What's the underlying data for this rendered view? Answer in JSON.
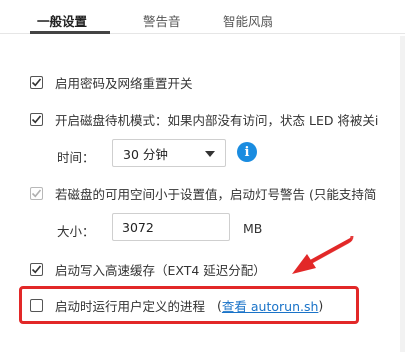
{
  "tabs": [
    {
      "label": "一般设置",
      "active": true
    },
    {
      "label": "警告音",
      "active": false
    },
    {
      "label": "智能风扇",
      "active": false
    }
  ],
  "settings": {
    "password_reset": {
      "label": "启用密码及网络重置开关",
      "checked": true
    },
    "disk_standby": {
      "label": "开启磁盘待机模式：如果内部没有访问，状态 LED 将被关i",
      "checked": true
    },
    "time_label": "时间：",
    "time_value": "30 分钟",
    "info_glyph": "i",
    "space_warning": {
      "label": "若磁盘的可用空间小于设置值，启动灯号警告 (只能支持简",
      "checked": true,
      "disabled": true
    },
    "size_label": "大小：",
    "size_value": "3072",
    "size_unit": "MB",
    "write_cache": {
      "label": "启动写入高速缓存（EXT4 延迟分配）",
      "checked": true
    },
    "autorun": {
      "label": "启动时运行用户定义的进程",
      "checked": false,
      "link_open": "(",
      "link_text": "查看 autorun.sh",
      "link_close": ")"
    }
  },
  "annotation_color": "#e22828",
  "accent": "#1a8ce0"
}
